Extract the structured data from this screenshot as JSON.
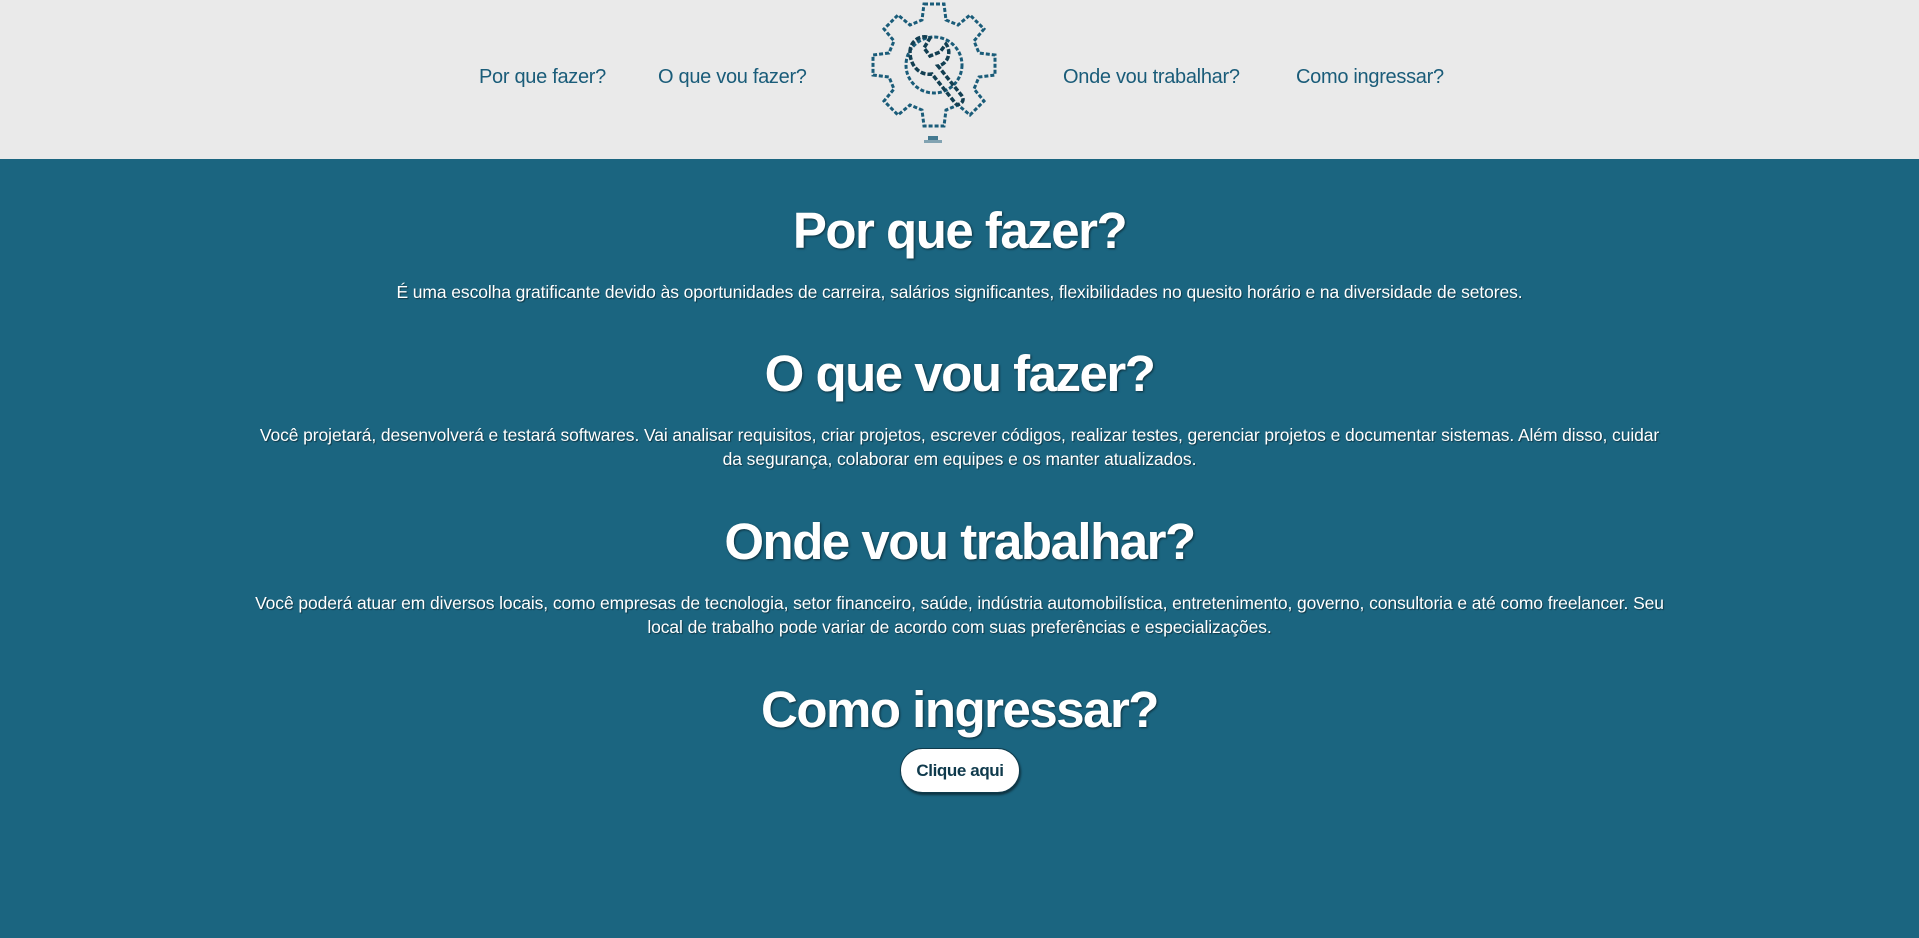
{
  "header": {
    "nav": [
      {
        "label": "Por que fazer?"
      },
      {
        "label": "O que vou fazer?"
      },
      {
        "label": "Onde vou trabalhar?"
      },
      {
        "label": "Como ingressar?"
      }
    ],
    "logo_icon": "gear-wrench-icon"
  },
  "sections": [
    {
      "title": "Por que fazer?",
      "text": "É uma escolha gratificante devido às oportunidades de carreira, salários significantes, flexibilidades no quesito horário e na diversidade de setores."
    },
    {
      "title": "O que vou fazer?",
      "text": "Você projetará, desenvolverá e testará softwares. Vai analisar requisitos, criar projetos, escrever códigos, realizar testes, gerenciar projetos e documentar sistemas. Além disso, cuidar da segurança, colaborar em equipes e os manter atualizados."
    },
    {
      "title": "Onde vou trabalhar?",
      "text": "Você poderá atuar em diversos locais, como empresas de tecnologia, setor financeiro, saúde, indústria automobilística, entretenimento, governo, consultoria e até como freelancer. Seu local de trabalho pode variar de acordo com suas preferências e especializações."
    },
    {
      "title": "Como ingressar?",
      "button_label": "Clique aqui"
    }
  ],
  "colors": {
    "header_bg": "#eaeaea",
    "main_bg": "#1b6580",
    "nav_text": "#1a5c79",
    "button_bg": "#ffffff"
  }
}
